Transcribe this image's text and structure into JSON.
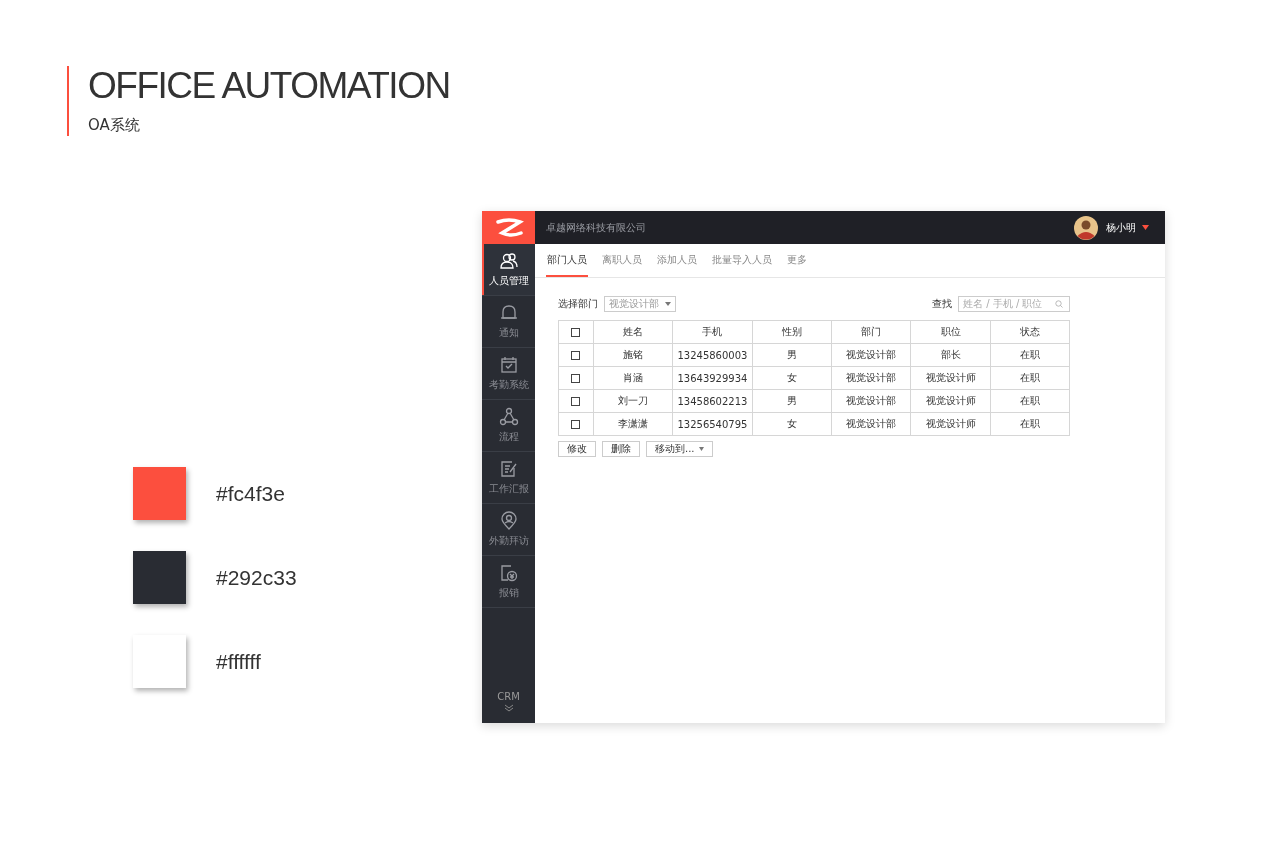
{
  "slide": {
    "title": "OFFICE AUTOMATION",
    "subtitle": "OA系统"
  },
  "palette": [
    {
      "color": "#fc4f3e",
      "label": "#fc4f3e"
    },
    {
      "color": "#292c33",
      "label": "#292c33"
    },
    {
      "color": "#ffffff",
      "label": "#ffffff"
    }
  ],
  "app": {
    "company": "卓越网络科技有限公司",
    "user": "杨小明",
    "sidebar": [
      {
        "kind": "people",
        "label": "人员管理",
        "selected": true
      },
      {
        "kind": "bell",
        "label": "通知",
        "selected": false
      },
      {
        "kind": "calendar",
        "label": "考勤系统",
        "selected": false
      },
      {
        "kind": "flow",
        "label": "流程",
        "selected": false
      },
      {
        "kind": "report",
        "label": "工作汇报",
        "selected": false
      },
      {
        "kind": "pin",
        "label": "外勤拜访",
        "selected": false
      },
      {
        "kind": "money",
        "label": "报销",
        "selected": false
      }
    ],
    "sidebar_footer": "CRM",
    "tabs": [
      {
        "label": "部门人员",
        "selected": true
      },
      {
        "label": "离职人员",
        "selected": false
      },
      {
        "label": "添加人员",
        "selected": false
      },
      {
        "label": "批量导入人员",
        "selected": false
      },
      {
        "label": "更多",
        "selected": false
      }
    ],
    "filter": {
      "label": "选择部门",
      "value": "视觉设计部"
    },
    "search": {
      "label": "查找",
      "placeholder": "姓名 / 手机 / 职位"
    },
    "table": {
      "header_checked": false,
      "columns": [
        "姓名",
        "手机",
        "性别",
        "部门",
        "职位",
        "状态"
      ],
      "rows": [
        {
          "checked": false,
          "cells": [
            "施铭",
            "13245860003",
            "男",
            "视觉设计部",
            "部长",
            "在职"
          ]
        },
        {
          "checked": false,
          "cells": [
            "肖涵",
            "13643929934",
            "女",
            "视觉设计部",
            "视觉设计师",
            "在职"
          ]
        },
        {
          "checked": false,
          "cells": [
            "刘一刀",
            "13458602213",
            "男",
            "视觉设计部",
            "视觉设计师",
            "在职"
          ]
        },
        {
          "checked": false,
          "cells": [
            "李潇潇",
            "13256540795",
            "女",
            "视觉设计部",
            "视觉设计师",
            "在职"
          ]
        }
      ]
    },
    "actions": [
      {
        "label": "修改",
        "dropdown": false
      },
      {
        "label": "删除",
        "dropdown": false
      },
      {
        "label": "移动到...",
        "dropdown": true
      }
    ]
  }
}
